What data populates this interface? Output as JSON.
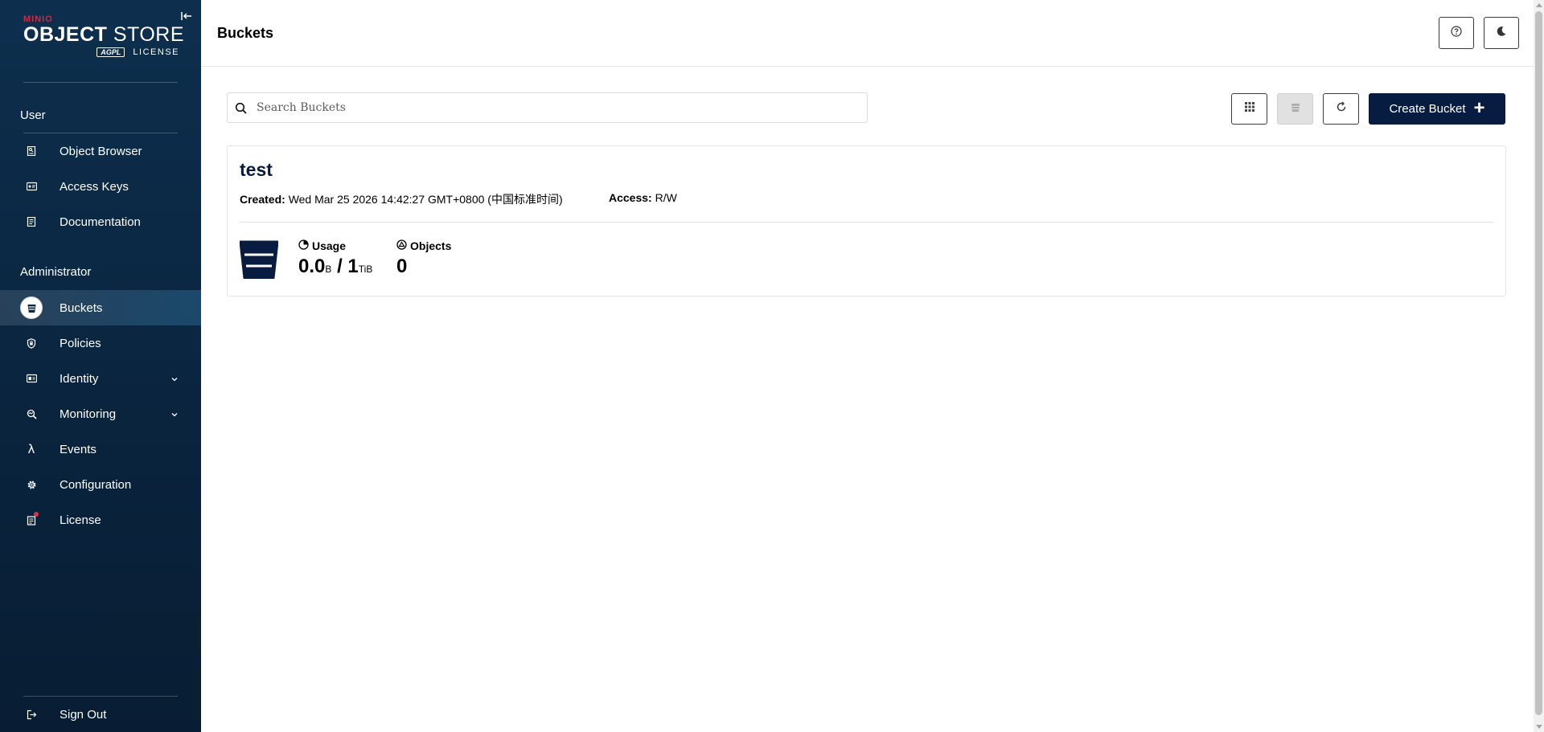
{
  "logo": {
    "brand_small": "MINIO",
    "brand_main_bold": "OBJECT",
    "brand_main_light": "STORE",
    "agpl": "AGPL",
    "license": "LICENSE"
  },
  "sidebar": {
    "user_section_title": "User",
    "user_items": [
      {
        "label": "Object Browser",
        "icon": "object-browser-icon"
      },
      {
        "label": "Access Keys",
        "icon": "access-keys-icon"
      },
      {
        "label": "Documentation",
        "icon": "documentation-icon"
      }
    ],
    "admin_section_title": "Administrator",
    "admin_items": [
      {
        "label": "Buckets",
        "icon": "bucket-icon",
        "active": true
      },
      {
        "label": "Policies",
        "icon": "shield-icon"
      },
      {
        "label": "Identity",
        "icon": "identity-icon",
        "expandable": true
      },
      {
        "label": "Monitoring",
        "icon": "monitoring-icon",
        "expandable": true
      },
      {
        "label": "Events",
        "icon": "lambda-icon"
      },
      {
        "label": "Configuration",
        "icon": "gear-icon"
      },
      {
        "label": "License",
        "icon": "license-icon",
        "notification": true
      }
    ],
    "sign_out": "Sign Out"
  },
  "header": {
    "title": "Buckets"
  },
  "toolbar": {
    "search_placeholder": "Search Buckets",
    "create_bucket_label": "Create Bucket"
  },
  "buckets": [
    {
      "name": "test",
      "created_label": "Created:",
      "created_value": "Wed Mar 25 2026 14:42:27 GMT+0800 (中国标准时间)",
      "access_label": "Access:",
      "access_value": "R/W",
      "usage_label": "Usage",
      "usage_used": "0.0",
      "usage_used_unit": "B",
      "usage_separator": "/",
      "usage_quota": "1",
      "usage_quota_unit": "TiB",
      "objects_label": "Objects",
      "objects_value": "0"
    }
  ],
  "colors": {
    "sidebar_bg": "#0a2540",
    "primary_button": "#081c42",
    "license_dot": "#e0303f"
  }
}
